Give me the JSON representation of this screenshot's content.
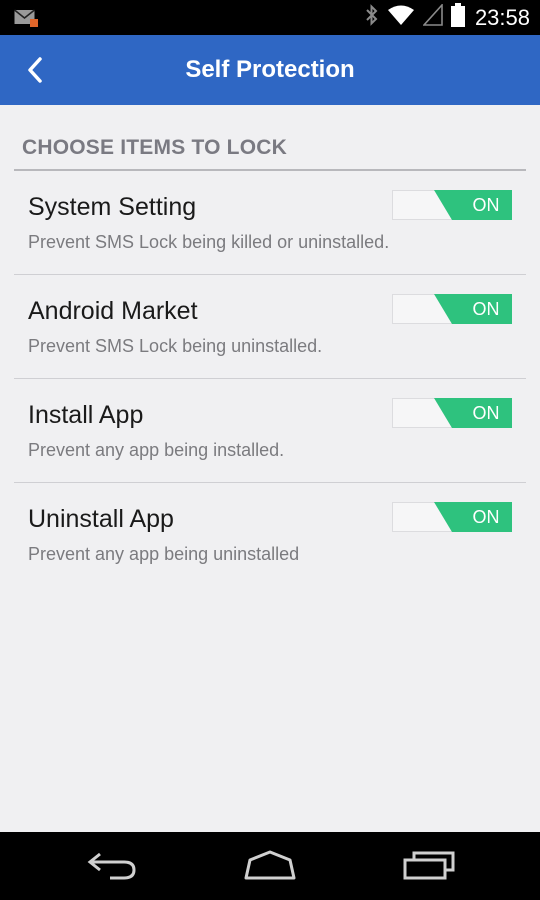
{
  "status_bar": {
    "time": "23:58",
    "icons": [
      "mail-icon",
      "bluetooth-icon",
      "wifi-icon",
      "signal-icon",
      "battery-icon"
    ]
  },
  "title_bar": {
    "title": "Self Protection",
    "back_icon": "back-arrow-icon"
  },
  "section": {
    "header": "CHOOSE ITEMS TO LOCK"
  },
  "items": [
    {
      "title": "System Setting",
      "description": "Prevent SMS Lock being killed or uninstalled.",
      "toggle_label": "ON",
      "on": true
    },
    {
      "title": "Android Market",
      "description": "Prevent SMS Lock being uninstalled.",
      "toggle_label": "ON",
      "on": true
    },
    {
      "title": "Install App",
      "description": "Prevent any app being installed.",
      "toggle_label": "ON",
      "on": true
    },
    {
      "title": "Uninstall App",
      "description": "Prevent any app being uninstalled",
      "toggle_label": "ON",
      "on": true
    }
  ],
  "nav_bar": {
    "icons": [
      "back-icon",
      "home-icon",
      "recents-icon"
    ]
  },
  "colors": {
    "app_bar": "#2f67c4",
    "toggle_on": "#2ec27e",
    "background": "#f0f0f2"
  }
}
